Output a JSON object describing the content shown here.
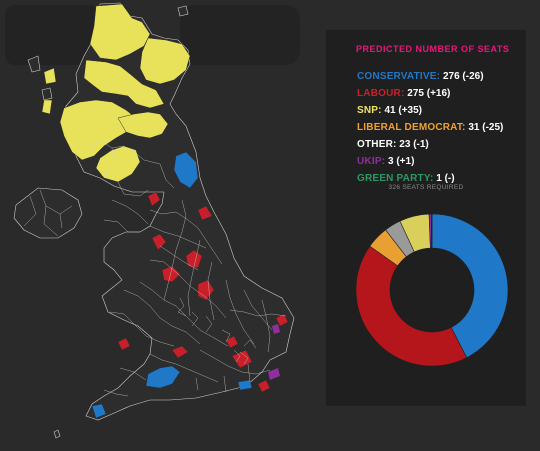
{
  "panel": {
    "title": "PREDICTED NUMBER OF SEATS",
    "title_color": "#e8177a",
    "seats_required": "326 SEATS REQUIRED",
    "parties": [
      {
        "name": "CONSERVATIVE:",
        "value": "276 (-26)",
        "color": "#1f78c8"
      },
      {
        "name": "LABOUR:",
        "value": "275 (+16)",
        "color": "#c8202a"
      },
      {
        "name": "SNP:",
        "value": "41 (+35)",
        "color": "#f2e463"
      },
      {
        "name": "LIBERAL DEMOCRAT:",
        "value": "31 (-25)",
        "color": "#f0a030"
      },
      {
        "name": "OTHER:",
        "value": "23 (-1)",
        "color": "#ffffff"
      },
      {
        "name": "UKIP:",
        "value": "3 (+1)",
        "color": "#8e2f9e"
      },
      {
        "name": "GREEN PARTY:",
        "value": "1 (-)",
        "color": "#2a9a62"
      }
    ]
  },
  "chart_data": {
    "type": "pie",
    "style": "donut",
    "categories": [
      "Conservative",
      "Labour",
      "Liberal Democrat",
      "Other",
      "SNP",
      "UKIP",
      "Green Party"
    ],
    "values": [
      276,
      275,
      31,
      23,
      41,
      3,
      1
    ],
    "colors": [
      "#1f78c8",
      "#b5161b",
      "#e8a032",
      "#9a9a9a",
      "#d8d05a",
      "#8e2f9e",
      "#2a9a62"
    ]
  },
  "map": {
    "colors": {
      "background": "#2a2a2a",
      "land": "#2d2d2d",
      "boundary": "#cfcfcf",
      "snp": "#e8e25a",
      "conservative": "#1f78c8",
      "labour": "#c8202a",
      "ukip": "#8e2f9e"
    }
  }
}
